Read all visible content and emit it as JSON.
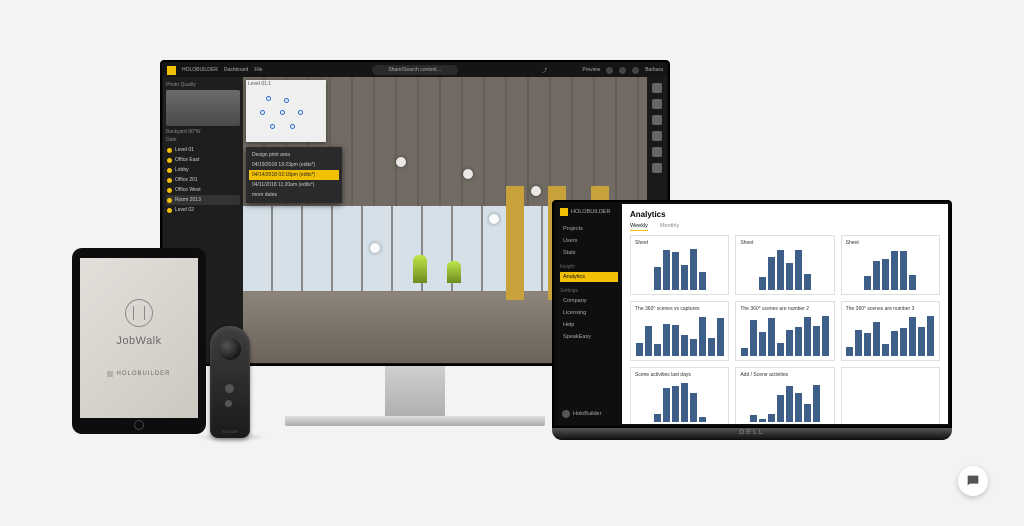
{
  "monitor": {
    "brand": "HOLOBUILDER",
    "menu": [
      "Dashboard",
      "File"
    ],
    "search_placeholder": "Share/Search content…",
    "header_right": {
      "preview": "Preview",
      "user": "Barbara"
    },
    "left_panel": {
      "section1": "Photo Quality",
      "location": "Backyard 90°W",
      "section2": "Date",
      "items": [
        {
          "label": "Level 01"
        },
        {
          "label": "Office East"
        },
        {
          "label": "Lobby"
        },
        {
          "label": "Office 201"
        },
        {
          "label": "Office West"
        },
        {
          "label": "Room 2013",
          "active": true
        },
        {
          "label": "Level 02"
        }
      ]
    },
    "context_menu": [
      "Design print area",
      "04/19/2018 19:23pm (edits*)",
      "04/14/2018 02:18pm (edits*)",
      "04/11/2018 11:20am (edits*)",
      "more dates"
    ],
    "floorplan_label": "Level 01.1",
    "toolbar_icons": [
      "save-icon",
      "undo-icon",
      "share-icon",
      "edit-icon",
      "layers-icon",
      "settings-icon"
    ]
  },
  "laptop": {
    "brand_label": "DELL",
    "sidebar": {
      "brand": "HOLOBUILDER",
      "sections": [
        {
          "header": "",
          "items": [
            "Projects",
            "Users",
            "Stats"
          ]
        },
        {
          "header": "Insight",
          "items": [
            {
              "label": "Analytics",
              "active": true
            }
          ]
        },
        {
          "header": "Settings",
          "items": [
            "Company",
            "Licensing"
          ]
        },
        {
          "header": "",
          "items": [
            "Help",
            "SpeakEasy"
          ]
        }
      ],
      "user": "HoloBuilder"
    },
    "page_title": "Analytics",
    "tabs": [
      "Weekly",
      "Monthly"
    ],
    "active_tab": "Weekly"
  },
  "tablet": {
    "app_name": "JobWalk",
    "brand": "HOLOBUILDER"
  },
  "camera": {
    "label": "RICOH"
  },
  "chart_data": [
    {
      "type": "bar",
      "title": "Sheet",
      "values": [
        55,
        95,
        90,
        60,
        98,
        42
      ]
    },
    {
      "type": "bar",
      "title": "Sheet",
      "values": [
        30,
        78,
        95,
        65,
        96,
        38
      ]
    },
    {
      "type": "bar",
      "title": "Sheet",
      "values": [
        34,
        70,
        74,
        94,
        92,
        36
      ]
    },
    {
      "type": "bar",
      "title": "The 360° scenes vs captures",
      "values": [
        30,
        72,
        28,
        76,
        74,
        50,
        40,
        92,
        44,
        90
      ]
    },
    {
      "type": "bar",
      "title": "The 360° scenes are number 2",
      "values": [
        20,
        86,
        56,
        90,
        30,
        62,
        70,
        94,
        72,
        96
      ]
    },
    {
      "type": "bar",
      "title": "The 360° scenes are number 3",
      "values": [
        22,
        62,
        54,
        82,
        28,
        60,
        66,
        94,
        70,
        96
      ]
    },
    {
      "type": "bar",
      "title": "Scene activities last days",
      "values": [
        18,
        80,
        86,
        92,
        70,
        12
      ]
    },
    {
      "type": "bar",
      "title": "Add / Scene activities",
      "values": [
        16,
        8,
        18,
        64,
        86,
        70,
        44,
        88
      ]
    },
    {
      "type": "bar",
      "title": "",
      "values": []
    }
  ]
}
